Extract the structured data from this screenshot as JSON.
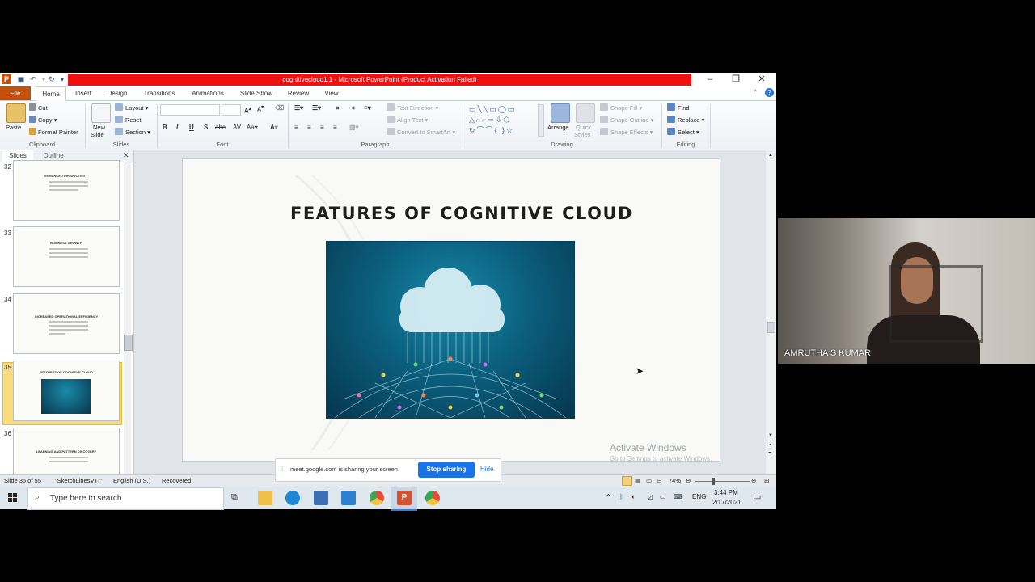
{
  "window": {
    "title": "cognitivecloud1.1 - Microsoft PowerPoint (Product Activation Failed)"
  },
  "tabs": [
    "File",
    "Home",
    "Insert",
    "Design",
    "Transitions",
    "Animations",
    "Slide Show",
    "Review",
    "View"
  ],
  "ribbon": {
    "clipboard": {
      "paste": "Paste",
      "cut": "Cut",
      "copy": "Copy",
      "format_painter": "Format Painter",
      "label": "Clipboard"
    },
    "slides": {
      "new_slide": "New",
      "new_slide2": "Slide",
      "layout": "Layout",
      "reset": "Reset",
      "section": "Section",
      "label": "Slides"
    },
    "font": {
      "label": "Font"
    },
    "paragraph": {
      "text_direction": "Text Direction",
      "align_text": "Align Text",
      "convert_smartart": "Convert to SmartArt",
      "label": "Paragraph"
    },
    "drawing": {
      "arrange": "Arrange",
      "quick": "Quick",
      "styles": "Styles",
      "shape_fill": "Shape Fill",
      "shape_outline": "Shape Outline",
      "shape_effects": "Shape Effects",
      "label": "Drawing"
    },
    "editing": {
      "find": "Find",
      "replace": "Replace",
      "select": "Select",
      "label": "Editing"
    }
  },
  "panel": {
    "tabs": [
      "Slides",
      "Outline"
    ],
    "slides": [
      {
        "num": "32",
        "title": "ENHANCED PRODUCTIVITY"
      },
      {
        "num": "33",
        "title": "BUSINESS GROWTH"
      },
      {
        "num": "34",
        "title": "INCREASED OPERATIONAL EFFICIENCY"
      },
      {
        "num": "35",
        "title": "FEATURES OF COGNITIVE CLOUD"
      },
      {
        "num": "36",
        "title": "LEARNING AND PATTERN DISCOVERY"
      }
    ]
  },
  "slide": {
    "title": "FEATURES OF COGNITIVE CLOUD"
  },
  "watermark": {
    "line1": "Activate Windows",
    "line2": "Go to Settings to activate Windows."
  },
  "status": {
    "slide_info": "Slide 35 of 55",
    "theme": "\"SketchLinesVTI\"",
    "language": "English (U.S.)",
    "recovered": "Recovered",
    "zoom": "74%"
  },
  "share_bar": {
    "text": "meet.google.com is sharing your screen.",
    "stop": "Stop sharing",
    "hide": "Hide"
  },
  "taskbar": {
    "search_placeholder": "Type here to search",
    "lang": "ENG",
    "time": "3:44 PM",
    "date": "2/17/2021"
  },
  "video": {
    "name": "AMRUTHA S KUMAR"
  }
}
